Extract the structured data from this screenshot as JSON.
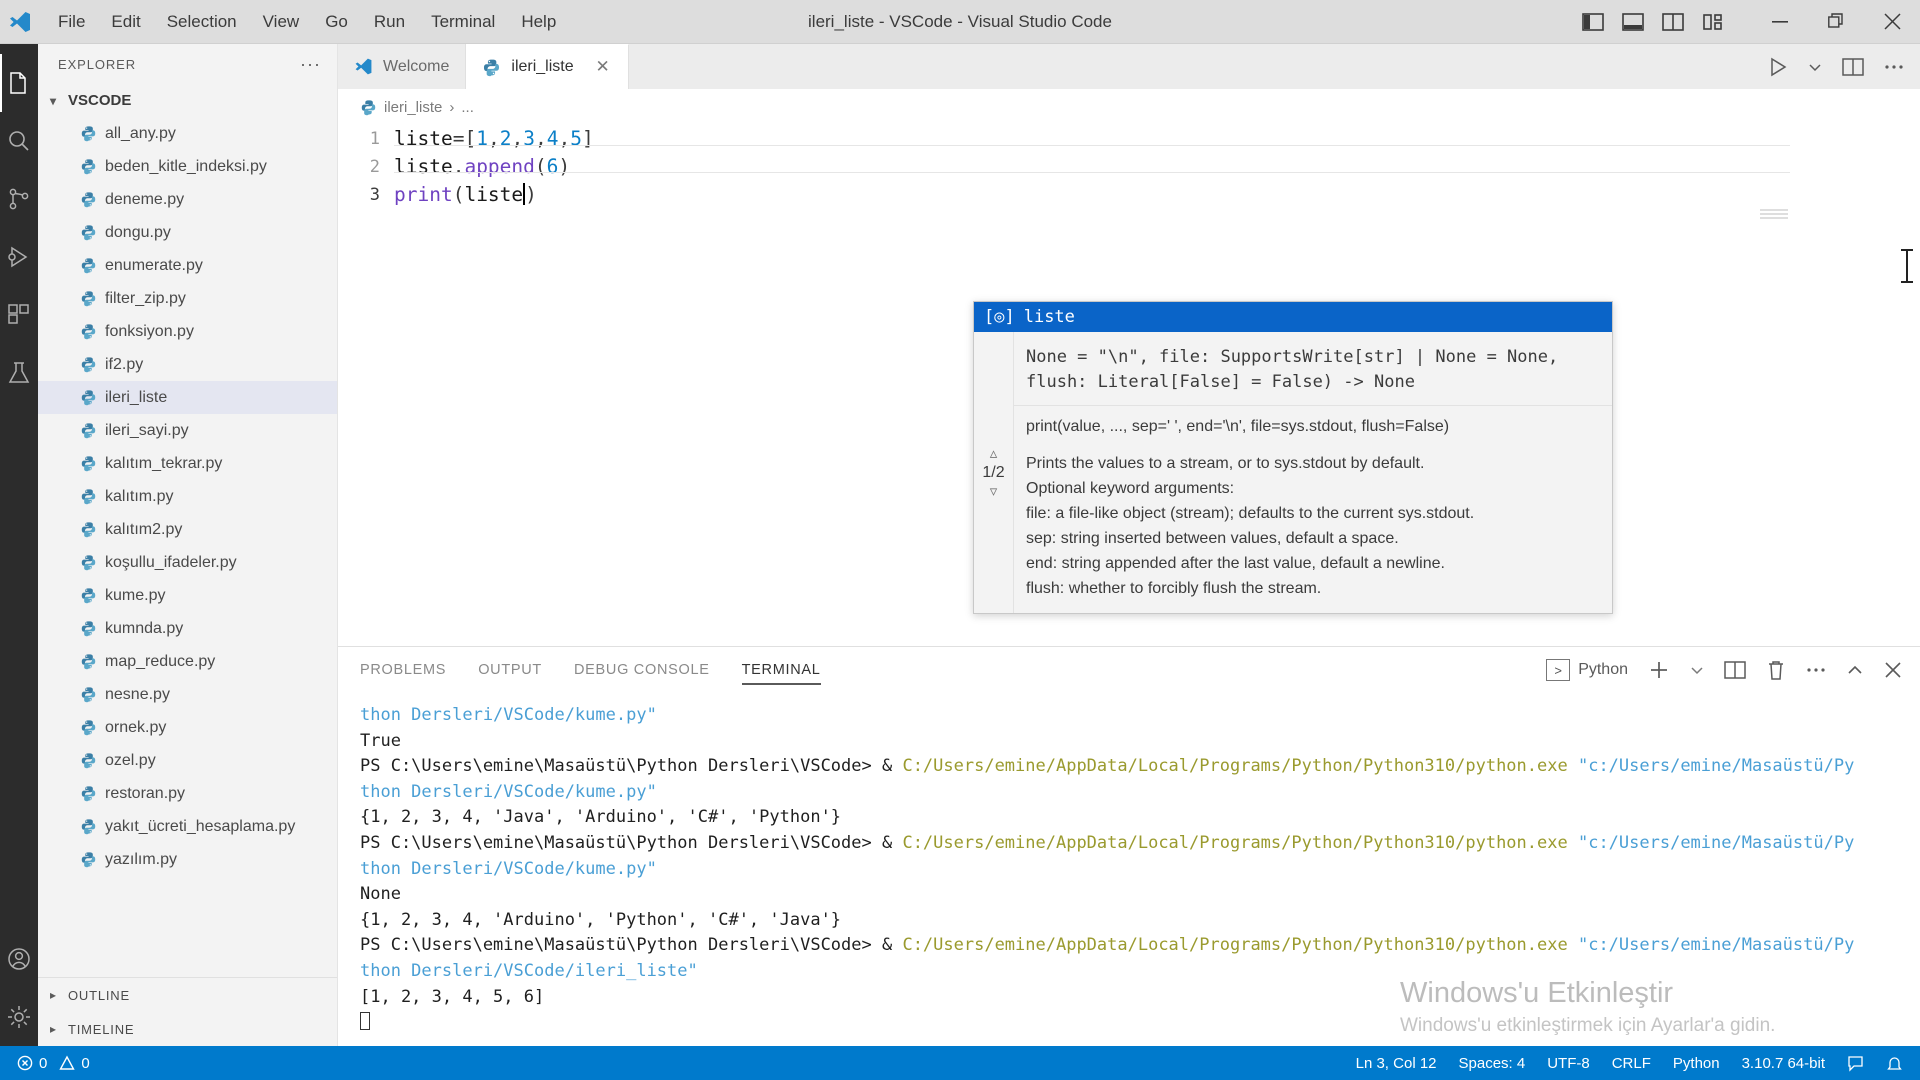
{
  "window": {
    "title": "ileri_liste - VSCode - Visual Studio Code",
    "menus": [
      "File",
      "Edit",
      "Selection",
      "View",
      "Go",
      "Run",
      "Terminal",
      "Help"
    ],
    "controls": {
      "toggle_primary_sidebar": "toggle-primary-sidebar",
      "toggle_panel": "toggle-panel",
      "toggle_secondary_sidebar": "toggle-secondary-sidebar",
      "customize_layout": "customize-layout",
      "minimize": "—",
      "restore": "restore",
      "close": "✕"
    }
  },
  "activitybar": {
    "items": [
      {
        "name": "explorer",
        "icon": "files-icon",
        "active": true
      },
      {
        "name": "search",
        "icon": "search-icon",
        "active": false
      },
      {
        "name": "source-control",
        "icon": "source-control-icon",
        "active": false
      },
      {
        "name": "run-and-debug",
        "icon": "run-debug-icon",
        "active": false
      },
      {
        "name": "extensions",
        "icon": "extensions-icon",
        "active": false
      },
      {
        "name": "testing",
        "icon": "beaker-icon",
        "active": false
      },
      {
        "name": "accounts",
        "icon": "account-icon",
        "active": false
      },
      {
        "name": "manage",
        "icon": "gear-icon",
        "active": false
      }
    ]
  },
  "sidebar": {
    "title": "EXPLORER",
    "more_actions": "···",
    "root": "VSCODE",
    "files": [
      {
        "label": "all_any.py",
        "selected": false
      },
      {
        "label": "beden_kitle_indeksi.py",
        "selected": false
      },
      {
        "label": "deneme.py",
        "selected": false
      },
      {
        "label": "dongu.py",
        "selected": false
      },
      {
        "label": "enumerate.py",
        "selected": false
      },
      {
        "label": "filter_zip.py",
        "selected": false
      },
      {
        "label": "fonksiyon.py",
        "selected": false
      },
      {
        "label": "if2.py",
        "selected": false
      },
      {
        "label": "ileri_liste",
        "selected": true
      },
      {
        "label": "ileri_sayi.py",
        "selected": false
      },
      {
        "label": "kalıtım_tekrar.py",
        "selected": false
      },
      {
        "label": "kalıtım.py",
        "selected": false
      },
      {
        "label": "kalıtım2.py",
        "selected": false
      },
      {
        "label": "koşullu_ifadeler.py",
        "selected": false
      },
      {
        "label": "kume.py",
        "selected": false
      },
      {
        "label": "kumnda.py",
        "selected": false
      },
      {
        "label": "map_reduce.py",
        "selected": false
      },
      {
        "label": "nesne.py",
        "selected": false
      },
      {
        "label": "ornek.py",
        "selected": false
      },
      {
        "label": "ozel.py",
        "selected": false
      },
      {
        "label": "restoran.py",
        "selected": false
      },
      {
        "label": "yakıt_ücreti_hesaplama.py",
        "selected": false
      },
      {
        "label": "yazılım.py",
        "selected": false
      }
    ],
    "sections": [
      {
        "label": "OUTLINE"
      },
      {
        "label": "TIMELINE"
      }
    ]
  },
  "editor": {
    "tabs": [
      {
        "label": "Welcome",
        "icon": "vscode-icon",
        "active": false,
        "closable": false
      },
      {
        "label": "ileri_liste",
        "icon": "python-icon",
        "active": true,
        "closable": true
      }
    ],
    "tab_actions": [
      "run-icon",
      "chevron-down-icon",
      "split-editor-icon",
      "more-actions-icon"
    ],
    "breadcrumb": {
      "file": "ileri_liste",
      "separator": "›",
      "rest": "..."
    },
    "lines": [
      {
        "number": "1",
        "tokens": [
          {
            "t": "liste",
            "c": "tok-var"
          },
          {
            "t": "=",
            "c": "tok-punct"
          },
          {
            "t": "[",
            "c": "tok-brk"
          },
          {
            "t": "1",
            "c": "tok-num"
          },
          {
            "t": ",",
            "c": "tok-punct"
          },
          {
            "t": "2",
            "c": "tok-num"
          },
          {
            "t": ",",
            "c": "tok-punct"
          },
          {
            "t": "3",
            "c": "tok-num"
          },
          {
            "t": ",",
            "c": "tok-punct"
          },
          {
            "t": "4",
            "c": "tok-num"
          },
          {
            "t": ",",
            "c": "tok-punct"
          },
          {
            "t": "5",
            "c": "tok-num"
          },
          {
            "t": "]",
            "c": "tok-brk"
          }
        ]
      },
      {
        "number": "2",
        "tokens": [
          {
            "t": "liste",
            "c": "tok-var"
          },
          {
            "t": ".",
            "c": "tok-punct"
          },
          {
            "t": "append",
            "c": "tok-fn"
          },
          {
            "t": "(",
            "c": "tok-brk"
          },
          {
            "t": "6",
            "c": "tok-num"
          },
          {
            "t": ")",
            "c": "tok-brk"
          }
        ]
      },
      {
        "number": "3",
        "tokens": [
          {
            "t": "print",
            "c": "tok-fn"
          },
          {
            "t": "(",
            "c": "tok-brk"
          },
          {
            "t": "liste",
            "c": "tok-var"
          }
        ],
        "caret": true,
        "after_caret": ")"
      }
    ]
  },
  "intellisense": {
    "header_label": "liste",
    "header_icon": "parameter-icon",
    "page": "1/2",
    "prev_icon": "chevron-up-icon",
    "next_icon": "chevron-down-icon",
    "signature": "None = \"\\n\", file: SupportsWrite[str] | None = None,\nflush: Literal[False] = False) -> None",
    "doc_lines": [
      {
        "text": "print(value, ..., sep=' ', end='\\n', file=sys.stdout, flush=False)",
        "spaced": true
      },
      {
        "text": "Prints the values to a stream, or to sys.stdout by default.",
        "spaced": false
      },
      {
        "text": "Optional keyword arguments:",
        "spaced": false
      },
      {
        "text": "file: a file-like object (stream); defaults to the current sys.stdout.",
        "spaced": false
      },
      {
        "text": "sep: string inserted between values, default a space.",
        "spaced": false
      },
      {
        "text": "end: string appended after the last value, default a newline.",
        "spaced": false
      },
      {
        "text": "flush: whether to forcibly flush the stream.",
        "spaced": false
      }
    ]
  },
  "panel": {
    "tabs": [
      {
        "label": "PROBLEMS",
        "active": false
      },
      {
        "label": "OUTPUT",
        "active": false
      },
      {
        "label": "DEBUG CONSOLE",
        "active": false
      },
      {
        "label": "TERMINAL",
        "active": true
      }
    ],
    "terminal_chip": "Python",
    "actions": [
      "add-terminal-icon",
      "chevron-down-icon",
      "split-terminal-icon",
      "kill-terminal-icon",
      "more-actions-icon",
      "collapse-panel-icon",
      "close-panel-icon"
    ],
    "terminal_lines": [
      [
        {
          "t": "thon Dersleri/VSCode/kume.py\"",
          "c": "t-blue"
        }
      ],
      [
        {
          "t": "True",
          "c": "t-plain"
        }
      ],
      [
        {
          "t": "PS C:\\Users\\emine\\Masaüstü\\Python Dersleri\\VSCode> & ",
          "c": "t-ps"
        },
        {
          "t": "C:/Users/emine/AppData/Local/Programs/Python/Python310/python.exe ",
          "c": "t-path"
        },
        {
          "t": "\"c:/Users/emine/Masaüstü/Py",
          "c": "t-blue"
        }
      ],
      [
        {
          "t": "thon Dersleri/VSCode/kume.py\"",
          "c": "t-blue"
        }
      ],
      [
        {
          "t": "{1, 2, 3, 4, 'Java', 'Arduino', 'C#', 'Python'}",
          "c": "t-plain"
        }
      ],
      [
        {
          "t": "PS C:\\Users\\emine\\Masaüstü\\Python Dersleri\\VSCode> & ",
          "c": "t-ps"
        },
        {
          "t": "C:/Users/emine/AppData/Local/Programs/Python/Python310/python.exe ",
          "c": "t-path"
        },
        {
          "t": "\"c:/Users/emine/Masaüstü/Py",
          "c": "t-blue"
        }
      ],
      [
        {
          "t": "thon Dersleri/VSCode/kume.py\"",
          "c": "t-blue"
        }
      ],
      [
        {
          "t": "None",
          "c": "t-plain"
        }
      ],
      [
        {
          "t": "{1, 2, 3, 4, 'Arduino', 'Python', 'C#', 'Java'}",
          "c": "t-plain"
        }
      ],
      [
        {
          "t": "PS C:\\Users\\emine\\Masaüstü\\Python Dersleri\\VSCode> & ",
          "c": "t-ps"
        },
        {
          "t": "C:/Users/emine/AppData/Local/Programs/Python/Python310/python.exe ",
          "c": "t-path"
        },
        {
          "t": "\"c:/Users/emine/Masaüstü/Py",
          "c": "t-blue"
        }
      ],
      [
        {
          "t": "thon Dersleri/VSCode/ileri_liste\"",
          "c": "t-blue"
        }
      ],
      [
        {
          "t": "[1, 2, 3, 4, 5, 6]",
          "c": "t-plain"
        }
      ]
    ]
  },
  "watermark": {
    "line1": "Windows'u Etkinleştir",
    "line2": "Windows'u etkinleştirmek için Ayarlar'a gidin."
  },
  "statusbar": {
    "errors": "0",
    "warnings": "0",
    "position": "Ln 3, Col 12",
    "indent": "Spaces: 4",
    "encoding": "UTF-8",
    "eol": "CRLF",
    "language": "Python",
    "interpreter": "3.10.7 64-bit",
    "feedback_icon": "feedback-icon",
    "bell_icon": "bell-icon"
  },
  "colors": {
    "accent": "#007acc",
    "selection_blue": "#0a64c8",
    "sidebar_bg": "#f3f3f3",
    "activitybar_bg": "#2c2c2c",
    "titlebar_bg": "#dddddd",
    "terminal_path": "#9a9a2e",
    "terminal_string": "#4a9fd5"
  }
}
